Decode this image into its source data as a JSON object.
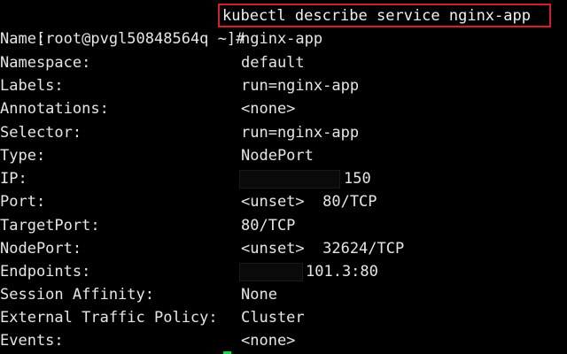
{
  "terminal": {
    "prompt": "[root@pvgl50848564q ~]#",
    "command": "kubectl describe service nginx-app",
    "fields": [
      {
        "key": "Name:",
        "value": "nginx-app"
      },
      {
        "key": "Namespace:",
        "value": "default"
      },
      {
        "key": "Labels:",
        "value": "run=nginx-app"
      },
      {
        "key": "Annotations:",
        "value": "<none>"
      },
      {
        "key": "Selector:",
        "value": "run=nginx-app"
      },
      {
        "key": "Type:",
        "value": "NodePort"
      },
      {
        "key": "IP:",
        "value": "150"
      },
      {
        "key": "Port:",
        "value": "<unset>  80/TCP"
      },
      {
        "key": "TargetPort:",
        "value": "80/TCP"
      },
      {
        "key": "NodePort:",
        "value": "<unset>  32624/TCP"
      },
      {
        "key": "Endpoints:",
        "value": "101.3:80"
      },
      {
        "key": "Session Affinity:",
        "value": "None"
      },
      {
        "key": "External Traffic Policy:",
        "value": "Cluster"
      },
      {
        "key": "Events:",
        "value": "<none>"
      }
    ],
    "colors": {
      "background": "#000000",
      "text": "#e6e6e6",
      "highlight_border": "#d4202a",
      "cursor": "#1fd14a"
    }
  }
}
